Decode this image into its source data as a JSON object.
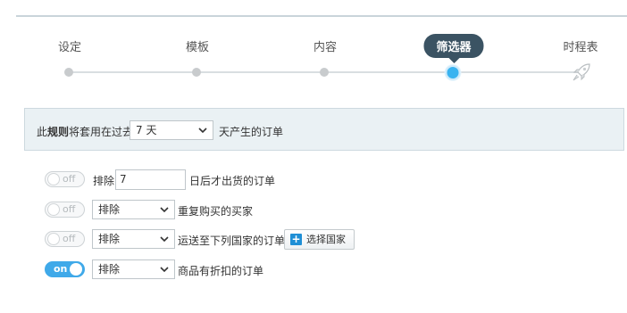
{
  "wizard": {
    "steps": [
      {
        "label": "设定"
      },
      {
        "label": "模板"
      },
      {
        "label": "内容"
      },
      {
        "label": "筛选器"
      },
      {
        "label": "时程表"
      }
    ],
    "active_step_label": "筛选器",
    "accent_color": "#39b3f0",
    "pill_color": "#3b5363"
  },
  "rule": {
    "text_prefix": "此",
    "text_bold": "规则",
    "text_middle": "将套用在过去",
    "period_value": "7 天",
    "text_suffix": "天产生的订单"
  },
  "filters": {
    "row1": {
      "toggle": "off",
      "prefix": "排除",
      "days_value": "7",
      "suffix": "日后才出货的订单"
    },
    "row2": {
      "toggle": "off",
      "select": "排除",
      "suffix": "重复购买的买家"
    },
    "row3": {
      "toggle": "off",
      "select": "排除",
      "suffix": "运送至下列国家的订单:",
      "button_label": "选择国家"
    },
    "row4": {
      "toggle": "on",
      "select": "排除",
      "suffix": "商品有折扣的订单"
    }
  }
}
